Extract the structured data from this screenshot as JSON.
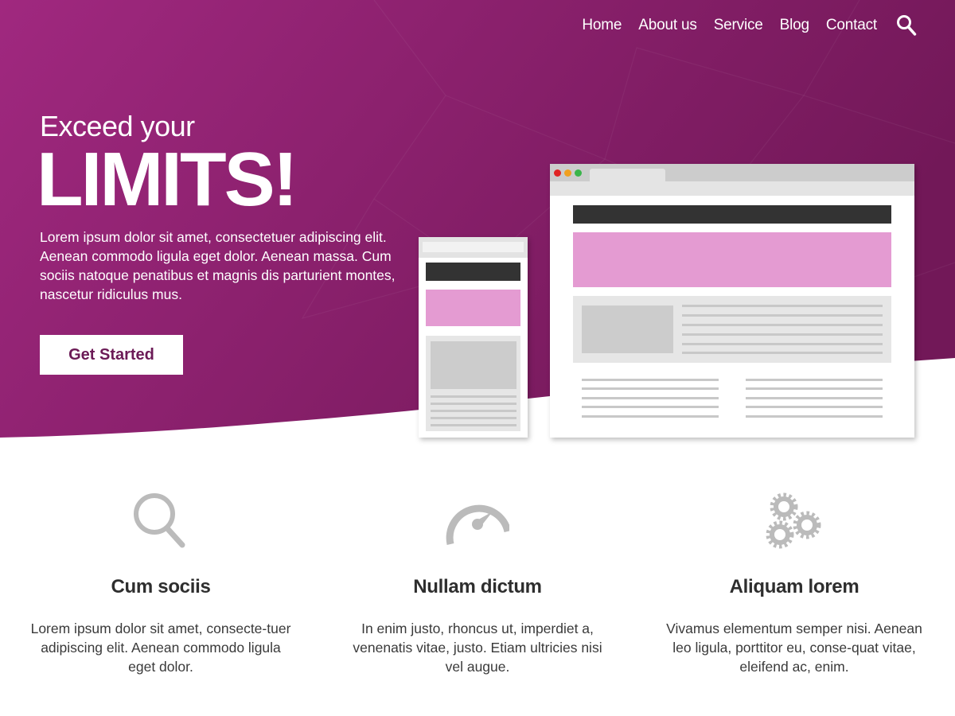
{
  "colors": {
    "hero_gradient_start": "#a0287f",
    "hero_gradient_end": "#721858",
    "cta_text": "#6b1a56",
    "mock_pink": "#e49bd2",
    "mock_dark": "#333333",
    "mock_gray": "#cccccc",
    "icon_gray": "#bbbbbb"
  },
  "nav": {
    "items": [
      "Home",
      "About us",
      "Service",
      "Blog",
      "Contact"
    ],
    "search_icon": "search-icon"
  },
  "hero": {
    "title_small": "Exceed your",
    "title_big": "LIMITS!",
    "text": "Lorem ipsum dolor sit amet, consectetuer adipiscing elit. Aenean commodo ligula eget dolor. Aenean massa. Cum sociis natoque penatibus et magnis dis parturient montes, nascetur ridiculus mus.",
    "cta_label": "Get Started"
  },
  "features": [
    {
      "icon": "magnifier-icon",
      "title": "Cum sociis",
      "text": "Lorem ipsum dolor sit amet, consecte-tuer adipiscing elit. Aenean commodo ligula eget dolor."
    },
    {
      "icon": "speedometer-icon",
      "title": "Nullam dictum",
      "text": "In enim justo, rhoncus ut, imperdiet a, venenatis vitae, justo. Etiam ultricies nisi vel augue."
    },
    {
      "icon": "gears-icon",
      "title": "Aliquam lorem",
      "text": "Vivamus elementum semper nisi. Aenean leo ligula, porttitor eu, conse-quat vitae, eleifend ac, enim."
    }
  ]
}
